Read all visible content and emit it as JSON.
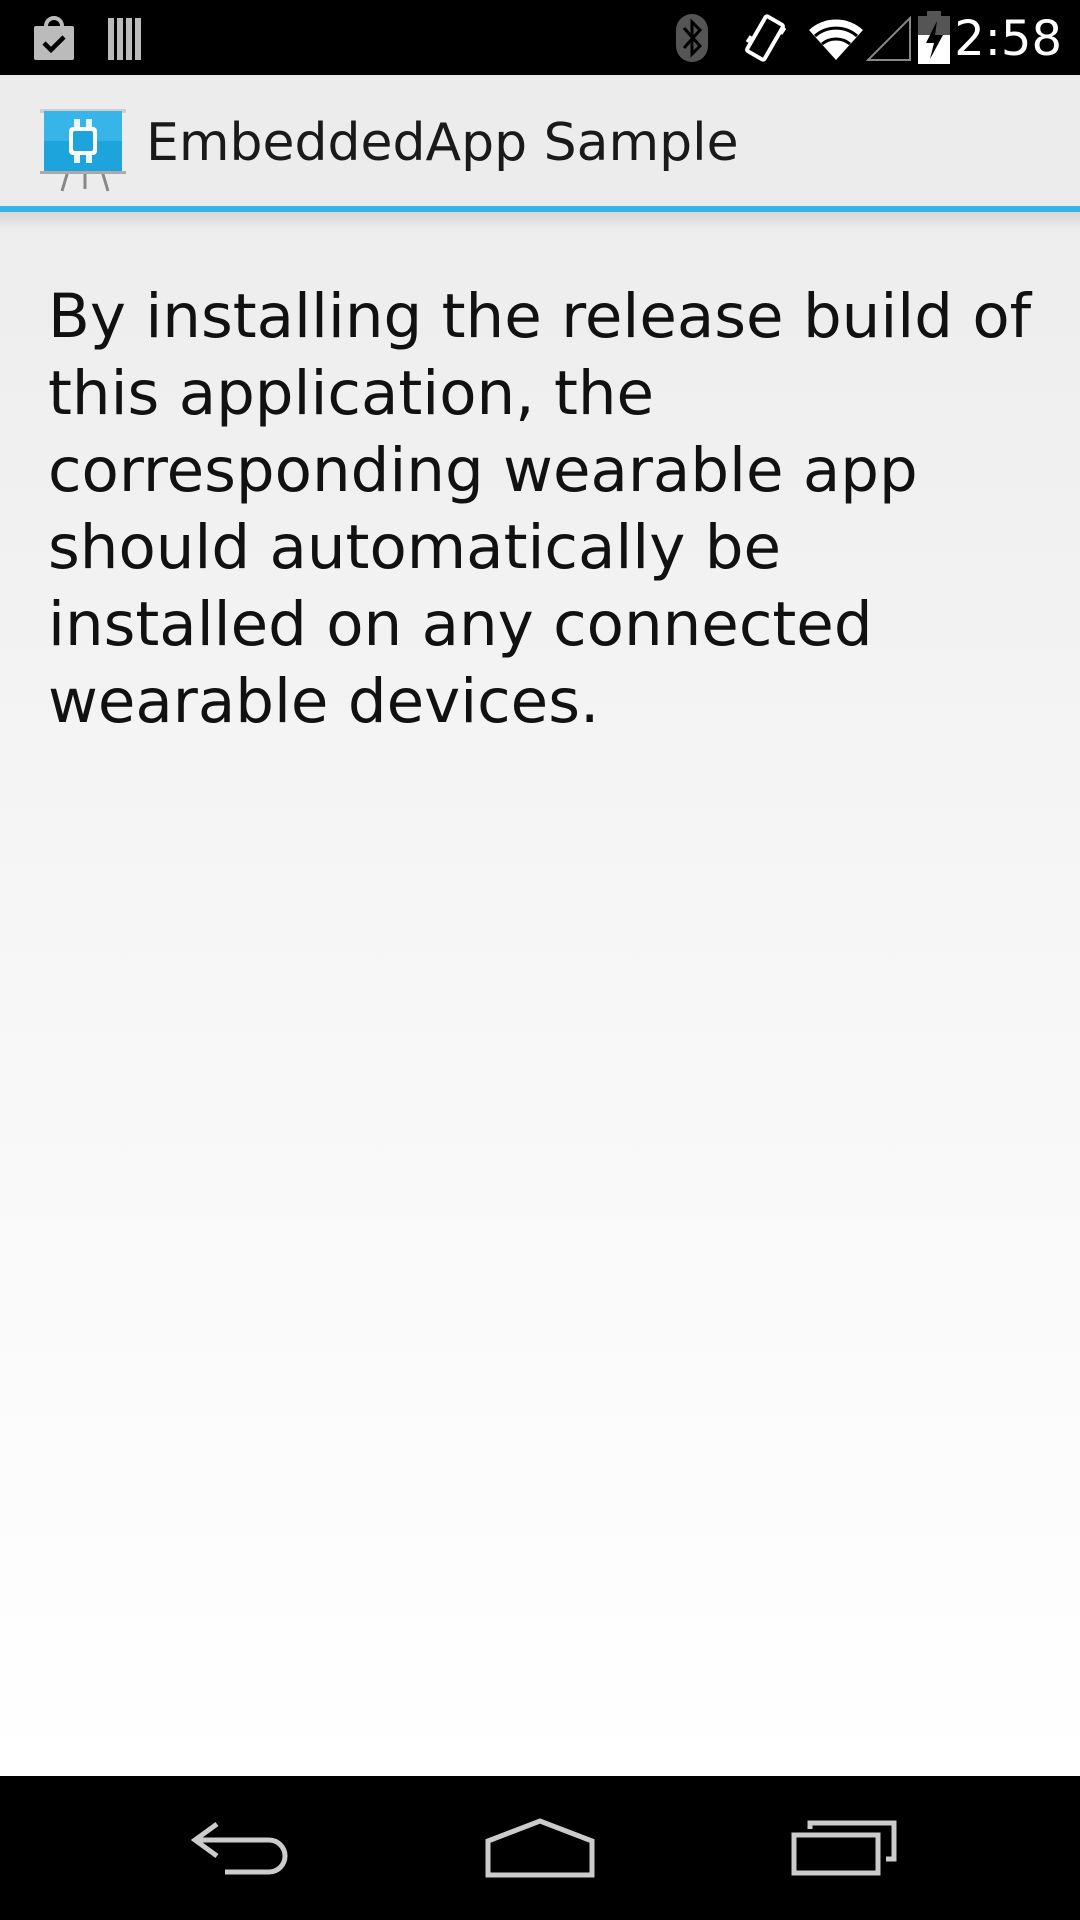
{
  "status_bar": {
    "time": "2:58",
    "icons": [
      "shopping-bag-check-icon",
      "sd-card-icon",
      "bluetooth-icon",
      "vibrate-icon",
      "wifi-icon",
      "signal-icon",
      "battery-charging-icon"
    ]
  },
  "action_bar": {
    "title": "EmbeddedApp Sample",
    "app_icon": "smartwatch-presentation-icon",
    "accent_color": "#33b5e5"
  },
  "main": {
    "message": "By installing the release build of this application, the corresponding wearable app should automatically be installed on any connected wearable devices."
  },
  "nav_bar": {
    "buttons": [
      "back-icon",
      "home-icon",
      "recent-apps-icon"
    ]
  }
}
